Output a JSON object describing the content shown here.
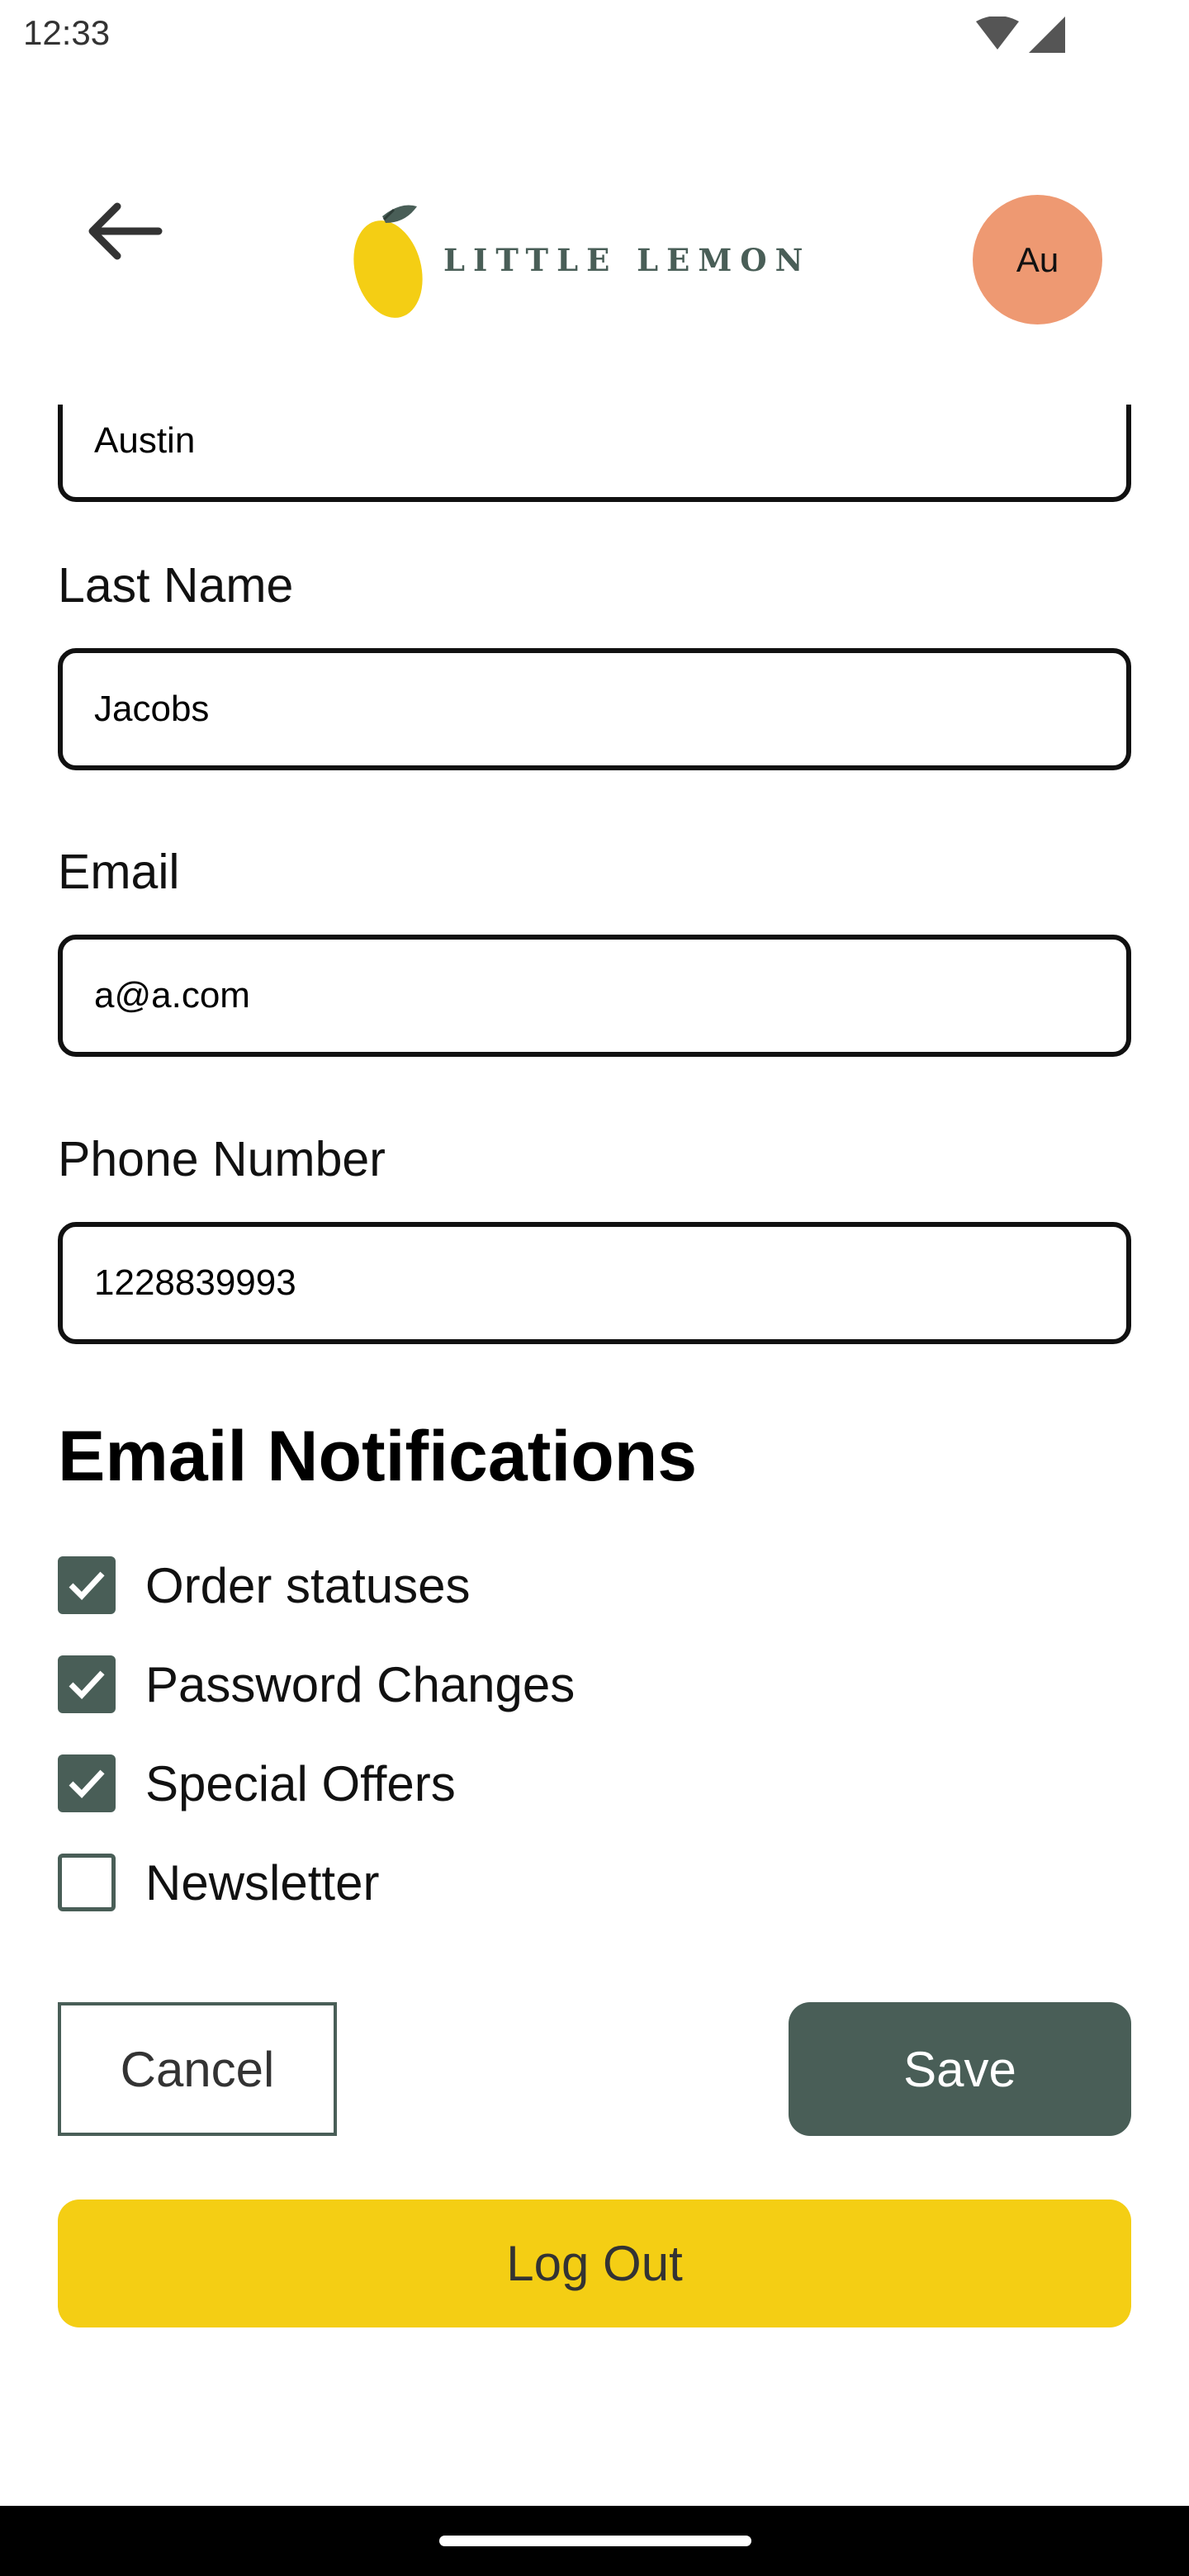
{
  "status_bar": {
    "time": "12:33",
    "icons": [
      "wifi-icon",
      "cell-signal-icon"
    ]
  },
  "header": {
    "logo_text": "LITTLE LEMON",
    "avatar_initials": "Au",
    "avatar_color": "#ee9972",
    "back_icon": "arrow-left-icon"
  },
  "form": {
    "first_name": {
      "value": "Austin"
    },
    "last_name": {
      "label": "Last Name",
      "value": "Jacobs"
    },
    "email": {
      "label": "Email",
      "value": "a@a.com"
    },
    "phone": {
      "label": "Phone Number",
      "value": "1228839993"
    }
  },
  "notifications": {
    "title": "Email Notifications",
    "items": [
      {
        "label": "Order statuses",
        "checked": true
      },
      {
        "label": "Password Changes",
        "checked": true
      },
      {
        "label": "Special Offers",
        "checked": true
      },
      {
        "label": "Newsletter",
        "checked": false
      }
    ]
  },
  "actions": {
    "cancel_label": "Cancel",
    "save_label": "Save",
    "logout_label": "Log Out"
  },
  "colors": {
    "primary": "#495e57",
    "accent_yellow": "#f4ce14",
    "avatar": "#ee9972"
  }
}
